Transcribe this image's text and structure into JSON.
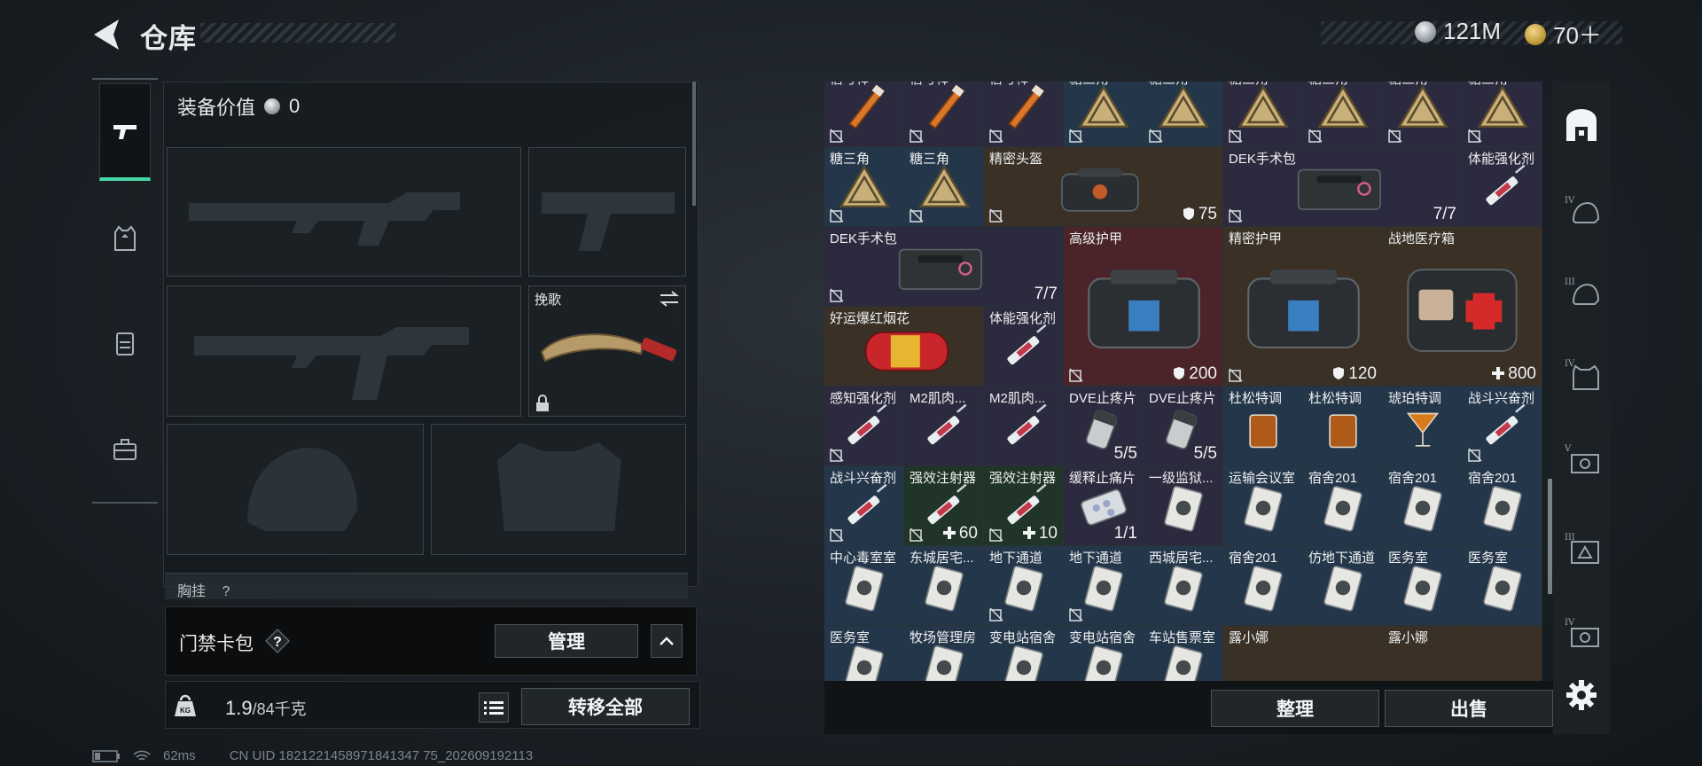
{
  "header": {
    "title": "仓库",
    "currency_silver": "121M",
    "currency_gold": "70＋"
  },
  "left": {
    "equipment_value_label": "装备价值",
    "equipment_value": "0",
    "melee_slot_label": "挽歌",
    "chest_rig_label": "胸挂",
    "chest_rig_extra": "?",
    "keycard_label": "门禁卡包",
    "keycard_help": "?",
    "manage_label": "管理",
    "weight_value": "1.9",
    "weight_capacity": "/84千克",
    "transfer_all_label": "转移全部"
  },
  "status": {
    "ping": "62ms",
    "uid": "CN UID 1821221458971841347 75_202609192113"
  },
  "grid_items": [
    {
      "name": "信号棒",
      "count": "",
      "bg": "purple",
      "icon": "flare"
    },
    {
      "name": "信号棒",
      "count": "",
      "bg": "purple",
      "icon": "flare"
    },
    {
      "name": "信号棒",
      "count": "",
      "bg": "purple",
      "icon": "flare"
    },
    {
      "name": "糖三角",
      "count": "",
      "bg": "blue",
      "icon": "triangle"
    },
    {
      "name": "糖三角",
      "count": "",
      "bg": "blue",
      "icon": "triangle"
    },
    {
      "name": "糖三角",
      "count": "",
      "bg": "purple",
      "icon": "triangle"
    },
    {
      "name": "糖三角",
      "count": "",
      "bg": "purple",
      "icon": "triangle"
    },
    {
      "name": "糖三角",
      "count": "",
      "bg": "purple",
      "icon": "triangle"
    },
    {
      "name": "糖三角",
      "count": "",
      "bg": "purple",
      "icon": "triangle"
    },
    {
      "name": "糖三角",
      "count": "",
      "bg": "blue",
      "icon": "triangle"
    },
    {
      "name": "糖三角",
      "count": "",
      "bg": "blue",
      "icon": "triangle"
    },
    {
      "name": "精密头盔",
      "count": "75",
      "bg": "gold",
      "icon": "bag"
    },
    {
      "name": "DEK手术包",
      "count": "7/7",
      "bg": "purple",
      "icon": "kit"
    },
    {
      "name": "体能强化剂",
      "count": "",
      "bg": "purple",
      "icon": "syringe"
    },
    {
      "name": "DEK手术包",
      "count": "7/7",
      "bg": "purple",
      "icon": "kit"
    },
    {
      "name": "高级护甲",
      "count": "200",
      "bg": "red",
      "icon": "bag-blue"
    },
    {
      "name": "精密护甲",
      "count": "120",
      "bg": "gold",
      "icon": "bag-blue"
    },
    {
      "name": "战地医疗箱",
      "count": "800",
      "bg": "gold",
      "icon": "medbox"
    },
    {
      "name": "好运爆红烟花",
      "count": "",
      "bg": "gold",
      "icon": "firework"
    },
    {
      "name": "体能强化剂",
      "count": "",
      "bg": "purple",
      "icon": "syringe"
    },
    {
      "name": "感知强化剂",
      "count": "",
      "bg": "purple",
      "icon": "syringe"
    },
    {
      "name": "M2肌肉...",
      "count": "",
      "bg": "purple",
      "icon": "syringe"
    },
    {
      "name": "M2肌肉...",
      "count": "",
      "bg": "purple",
      "icon": "syringe"
    },
    {
      "name": "DVE止疼片",
      "count": "5/5",
      "bg": "purple",
      "icon": "pills"
    },
    {
      "name": "DVE止疼片",
      "count": "5/5",
      "bg": "purple",
      "icon": "pills"
    },
    {
      "name": "杜松特调",
      "count": "",
      "bg": "blue",
      "icon": "drink"
    },
    {
      "name": "杜松特调",
      "count": "",
      "bg": "blue",
      "icon": "drink"
    },
    {
      "name": "琥珀特调",
      "count": "",
      "bg": "blue",
      "icon": "cocktail"
    },
    {
      "name": "战斗兴奋剂",
      "count": "",
      "bg": "blue",
      "icon": "syringe"
    },
    {
      "name": "战斗兴奋剂",
      "count": "",
      "bg": "blue",
      "icon": "syringe"
    },
    {
      "name": "强效注射器",
      "count": "60",
      "bg": "green",
      "icon": "syringe"
    },
    {
      "name": "强效注射器",
      "count": "10",
      "bg": "green",
      "icon": "syringe"
    },
    {
      "name": "缓释止痛片",
      "count": "1/1",
      "bg": "purple",
      "icon": "blister"
    },
    {
      "name": "一级监狱...",
      "count": "",
      "bg": "purple",
      "icon": "card"
    },
    {
      "name": "运输会议室",
      "count": "",
      "bg": "blue",
      "icon": "card"
    },
    {
      "name": "宿舍201",
      "count": "",
      "bg": "blue",
      "icon": "card"
    },
    {
      "name": "宿舍201",
      "count": "",
      "bg": "blue",
      "icon": "card"
    },
    {
      "name": "宿舍201",
      "count": "",
      "bg": "blue",
      "icon": "card"
    },
    {
      "name": "中心毒室室",
      "count": "",
      "bg": "blue",
      "icon": "card"
    },
    {
      "name": "东城居宅...",
      "count": "",
      "bg": "blue",
      "icon": "card"
    },
    {
      "name": "地下通道",
      "count": "",
      "bg": "blue",
      "icon": "card"
    },
    {
      "name": "地下通道",
      "count": "",
      "bg": "blue",
      "icon": "card"
    },
    {
      "name": "西城居宅...",
      "count": "",
      "bg": "blue",
      "icon": "card"
    },
    {
      "name": "宿舍201",
      "count": "",
      "bg": "blue",
      "icon": "card"
    },
    {
      "name": "仿地下通道",
      "count": "",
      "bg": "blue",
      "icon": "card"
    },
    {
      "name": "医务室",
      "count": "",
      "bg": "blue",
      "icon": "card"
    },
    {
      "name": "医务室",
      "count": "",
      "bg": "blue",
      "icon": "card"
    },
    {
      "name": "医务室",
      "count": "",
      "bg": "blue",
      "icon": "card"
    },
    {
      "name": "牧场管理房",
      "count": "",
      "bg": "blue",
      "icon": "card"
    },
    {
      "name": "变电站宿舍",
      "count": "",
      "bg": "blue",
      "icon": "card"
    },
    {
      "name": "变电站宿舍",
      "count": "",
      "bg": "blue",
      "icon": "card"
    },
    {
      "name": "车站售票室",
      "count": "",
      "bg": "blue",
      "icon": "card"
    },
    {
      "name": "露小娜",
      "count": "",
      "bg": "gold",
      "icon": "none"
    },
    {
      "name": "露小娜",
      "count": "",
      "bg": "gold",
      "icon": "none"
    }
  ],
  "bottom": {
    "sort_label": "整理",
    "sell_label": "出售"
  },
  "colors": {
    "accent_green": "#46d6a3",
    "rarity_red": "#4a2428",
    "rarity_gold": "#3a3026",
    "rarity_purple": "#2c2a3e",
    "rarity_blue": "#24374a"
  }
}
